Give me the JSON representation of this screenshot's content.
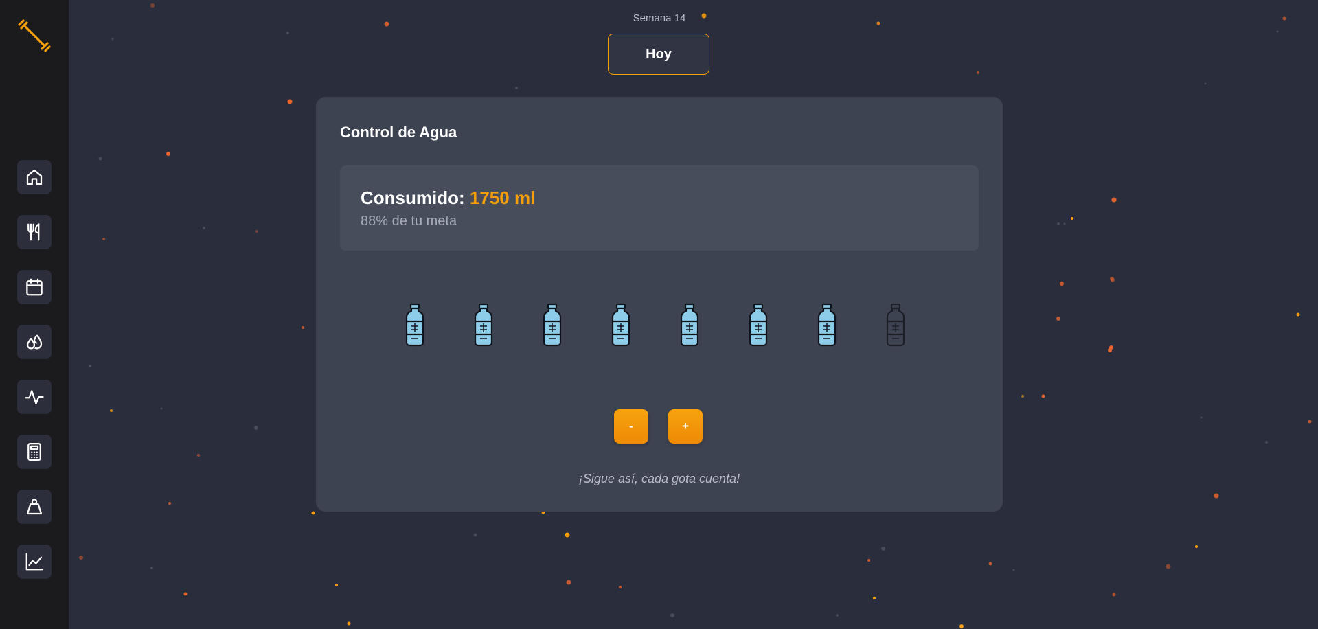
{
  "sidebar": {
    "logo_icon": "dumbbell-icon",
    "items": [
      {
        "id": "home",
        "icon": "home-icon"
      },
      {
        "id": "meals",
        "icon": "fork-knife-icon"
      },
      {
        "id": "calendar",
        "icon": "calendar-icon"
      },
      {
        "id": "water",
        "icon": "water-drops-icon"
      },
      {
        "id": "activity",
        "icon": "activity-pulse-icon"
      },
      {
        "id": "calculator",
        "icon": "calculator-icon"
      },
      {
        "id": "weight",
        "icon": "weight-icon"
      },
      {
        "id": "progress",
        "icon": "line-chart-icon"
      }
    ]
  },
  "header": {
    "week_label": "Semana 14",
    "today_button": "Hoy"
  },
  "water_card": {
    "title": "Control de Agua",
    "consumed_label": "Consumido:",
    "consumed_value": "1750 ml",
    "progress_text": "88% de tu meta",
    "bottles_filled": 7,
    "bottles_total": 8,
    "decrement_label": "-",
    "increment_label": "+",
    "encouragement": "¡Sigue así, cada gota cuenta!"
  },
  "colors": {
    "accent": "#f59e0b",
    "background": "#2a2d3b",
    "sidebar": "#1b1b1d",
    "card": "#3e4352",
    "water_fill": "#8ecdea"
  }
}
